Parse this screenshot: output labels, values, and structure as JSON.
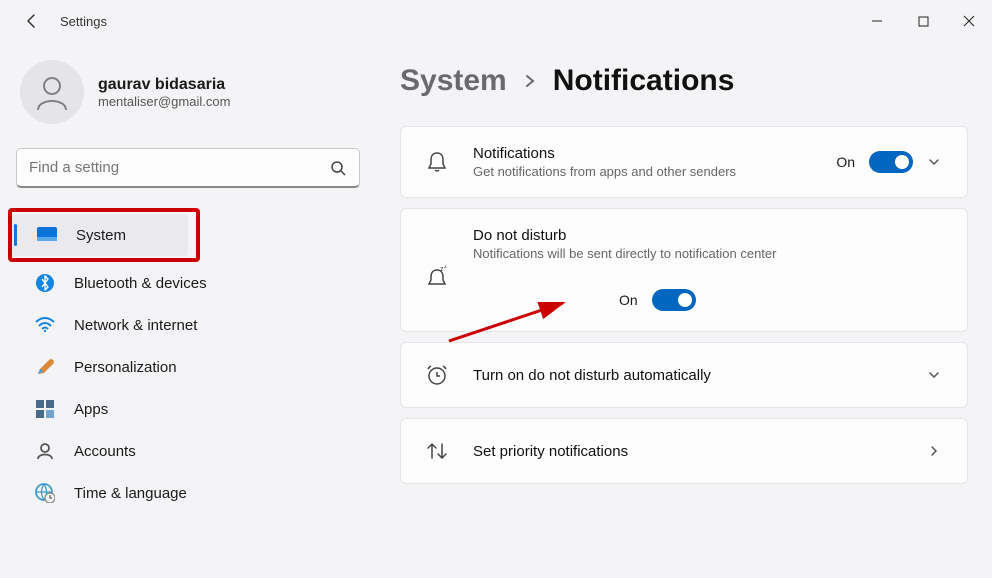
{
  "titlebar": {
    "app_title": "Settings"
  },
  "user": {
    "name": "gaurav bidasaria",
    "email": "mentaliser@gmail.com"
  },
  "search": {
    "placeholder": "Find a setting"
  },
  "sidebar": {
    "items": [
      {
        "label": "System"
      },
      {
        "label": "Bluetooth & devices"
      },
      {
        "label": "Network & internet"
      },
      {
        "label": "Personalization"
      },
      {
        "label": "Apps"
      },
      {
        "label": "Accounts"
      },
      {
        "label": "Time & language"
      }
    ]
  },
  "breadcrumb": {
    "parent": "System",
    "current": "Notifications"
  },
  "cards": {
    "notifications": {
      "title": "Notifications",
      "desc": "Get notifications from apps and other senders",
      "state": "On"
    },
    "dnd": {
      "title": "Do not disturb",
      "desc": "Notifications will be sent directly to notification center",
      "state": "On"
    },
    "schedule": {
      "title": "Turn on do not disturb automatically"
    },
    "priority": {
      "title": "Set priority notifications"
    }
  }
}
